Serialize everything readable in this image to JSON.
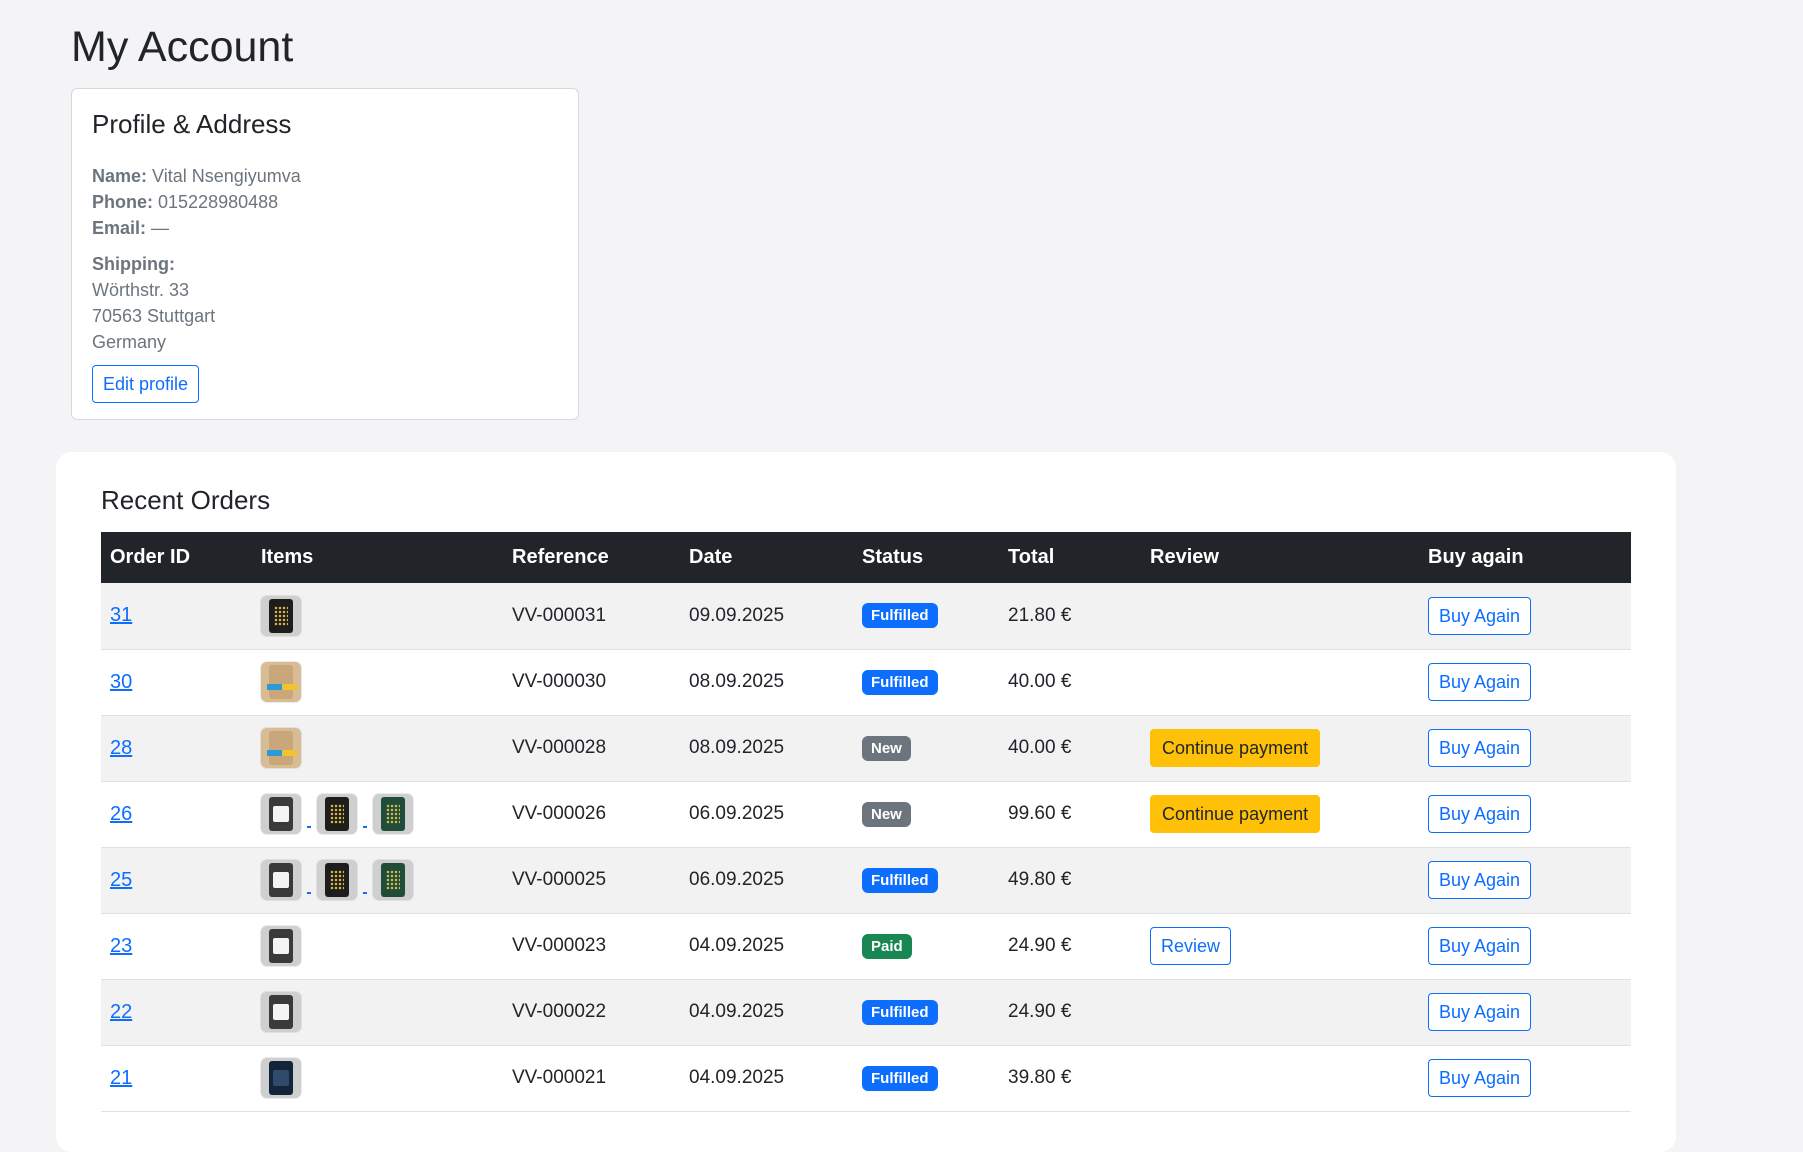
{
  "page": {
    "title": "My Account"
  },
  "profile": {
    "heading": "Profile & Address",
    "name_label": "Name:",
    "name": "Vital Nsengiyumva",
    "phone_label": "Phone:",
    "phone": "015228980488",
    "email_label": "Email:",
    "email": "—",
    "shipping_label": "Shipping:",
    "street": "Wörthstr. 33",
    "city": "70563 Stuttgart",
    "country": "Germany",
    "edit_button": "Edit profile"
  },
  "orders": {
    "heading": "Recent Orders",
    "columns": {
      "order_id": "Order ID",
      "items": "Items",
      "reference": "Reference",
      "date": "Date",
      "status": "Status",
      "total": "Total",
      "review": "Review",
      "buy_again": "Buy again"
    },
    "rows": [
      {
        "id": "31",
        "items": [
          "black-gold-bag"
        ],
        "reference": "VV-000031",
        "date": "09.09.2025",
        "status": "Fulfilled",
        "status_kind": "fulfilled",
        "total": "21.80 €",
        "review": "",
        "buy_again": "Buy Again"
      },
      {
        "id": "30",
        "items": [
          "kraft-stripe-bag"
        ],
        "reference": "VV-000030",
        "date": "08.09.2025",
        "status": "Fulfilled",
        "status_kind": "fulfilled",
        "total": "40.00 €",
        "review": "",
        "buy_again": "Buy Again"
      },
      {
        "id": "28",
        "items": [
          "kraft-stripe-bag"
        ],
        "reference": "VV-000028",
        "date": "08.09.2025",
        "status": "New",
        "status_kind": "new",
        "total": "40.00 €",
        "review": "Continue payment",
        "review_kind": "warning",
        "buy_again": "Buy Again"
      },
      {
        "id": "26",
        "items": [
          "grey-label-bag",
          "black-gold-bag",
          "green-bag"
        ],
        "reference": "VV-000026",
        "date": "06.09.2025",
        "status": "New",
        "status_kind": "new",
        "total": "99.60 €",
        "review": "Continue payment",
        "review_kind": "warning",
        "buy_again": "Buy Again"
      },
      {
        "id": "25",
        "items": [
          "grey-label-bag",
          "black-gold-bag",
          "green-bag"
        ],
        "reference": "VV-000025",
        "date": "06.09.2025",
        "status": "Fulfilled",
        "status_kind": "fulfilled",
        "total": "49.80 €",
        "review": "",
        "buy_again": "Buy Again"
      },
      {
        "id": "23",
        "items": [
          "grey-label-bag"
        ],
        "reference": "VV-000023",
        "date": "04.09.2025",
        "status": "Paid",
        "status_kind": "paid",
        "total": "24.90 €",
        "review": "Review",
        "review_kind": "outline",
        "buy_again": "Buy Again"
      },
      {
        "id": "22",
        "items": [
          "grey-label-bag"
        ],
        "reference": "VV-000022",
        "date": "04.09.2025",
        "status": "Fulfilled",
        "status_kind": "fulfilled",
        "total": "24.90 €",
        "review": "",
        "buy_again": "Buy Again"
      },
      {
        "id": "21",
        "items": [
          "navy-bag"
        ],
        "reference": "VV-000021",
        "date": "04.09.2025",
        "status": "Fulfilled",
        "status_kind": "fulfilled",
        "total": "39.80 €",
        "review": "",
        "buy_again": "Buy Again"
      }
    ]
  },
  "colors": {
    "primary": "#0d6efd",
    "secondary": "#6c757d",
    "success": "#198754",
    "warning": "#ffc107",
    "table_header": "#212529"
  }
}
